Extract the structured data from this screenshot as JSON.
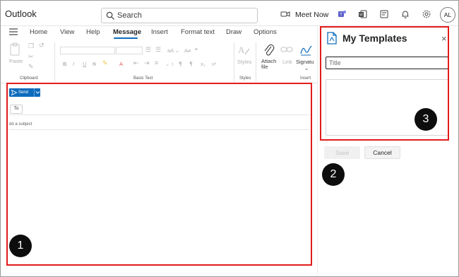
{
  "app": {
    "title": "Outlook"
  },
  "search": {
    "placeholder": "Search"
  },
  "toolbar": {
    "meet_now_label": "Meet Now",
    "avatar_initials": "AL"
  },
  "ribbon": {
    "tabs": [
      {
        "label": "Home"
      },
      {
        "label": "View"
      },
      {
        "label": "Help"
      },
      {
        "label": "Message",
        "active": true
      },
      {
        "label": "Insert"
      },
      {
        "label": "Format text"
      },
      {
        "label": "Draw"
      },
      {
        "label": "Options"
      }
    ],
    "groups": {
      "clipboard": {
        "label": "Clipboard",
        "paste_label": "Paste"
      },
      "basic_text": {
        "label": "Basic Text"
      },
      "styles": {
        "label": "Styles",
        "styles_label": "Styles"
      },
      "insert": {
        "label": "Insert",
        "attach_label": "Attach file",
        "link_label": "Link",
        "signature_label": "Signatu"
      }
    }
  },
  "compose": {
    "send_label": "Send",
    "to_label": "To",
    "subject_placeholder": "dd a subject"
  },
  "templates_pane": {
    "title": "My Templates",
    "close_glyph": "×",
    "title_placeholder": "Title",
    "save_label": "Save",
    "cancel_label": "Cancel"
  },
  "annotations": [
    {
      "number": "1"
    },
    {
      "number": "2"
    },
    {
      "number": "3"
    }
  ],
  "colors": {
    "accent": "#0f6cbd",
    "callout": "#e21c1c",
    "marker": "#0d0d0d"
  }
}
